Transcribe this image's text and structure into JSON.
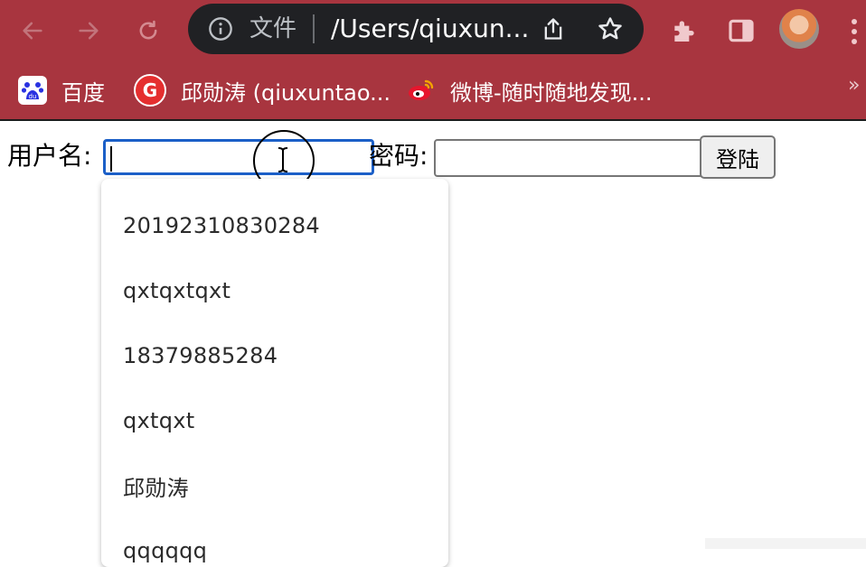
{
  "browser": {
    "omnibox": {
      "scheme_label": "文件",
      "url": "/Users/qiuxun..."
    },
    "icons": {
      "back": "arrow-left-icon",
      "forward": "arrow-right-icon",
      "reload": "reload-icon",
      "info": "info-icon",
      "share": "share-icon",
      "bookmark": "star-icon",
      "extensions": "puzzle-icon",
      "side_panel": "side-panel-icon",
      "menu": "more-vertical-icon"
    },
    "bookmarks": [
      {
        "label": "百度",
        "icon": "baidu-icon"
      },
      {
        "label": "邱勋涛 (qiuxuntao...",
        "icon": "g-logo-icon"
      },
      {
        "label": "微博-随时随地发现...",
        "icon": "weibo-icon"
      }
    ],
    "bookmarks_overflow": "»",
    "colors": {
      "frame": "#a8353f",
      "omnibox": "#202124",
      "focus": "#1b5fc7"
    }
  },
  "form": {
    "username_label": "用户名:",
    "username_value": "",
    "password_label": "密码:",
    "password_value": "",
    "login_button": "登陆"
  },
  "autocomplete": {
    "suggestions": [
      "20192310830284",
      "qxtqxtqxt",
      "18379885284",
      "qxtqxt",
      "邱勋涛",
      "qqqqqq"
    ]
  }
}
